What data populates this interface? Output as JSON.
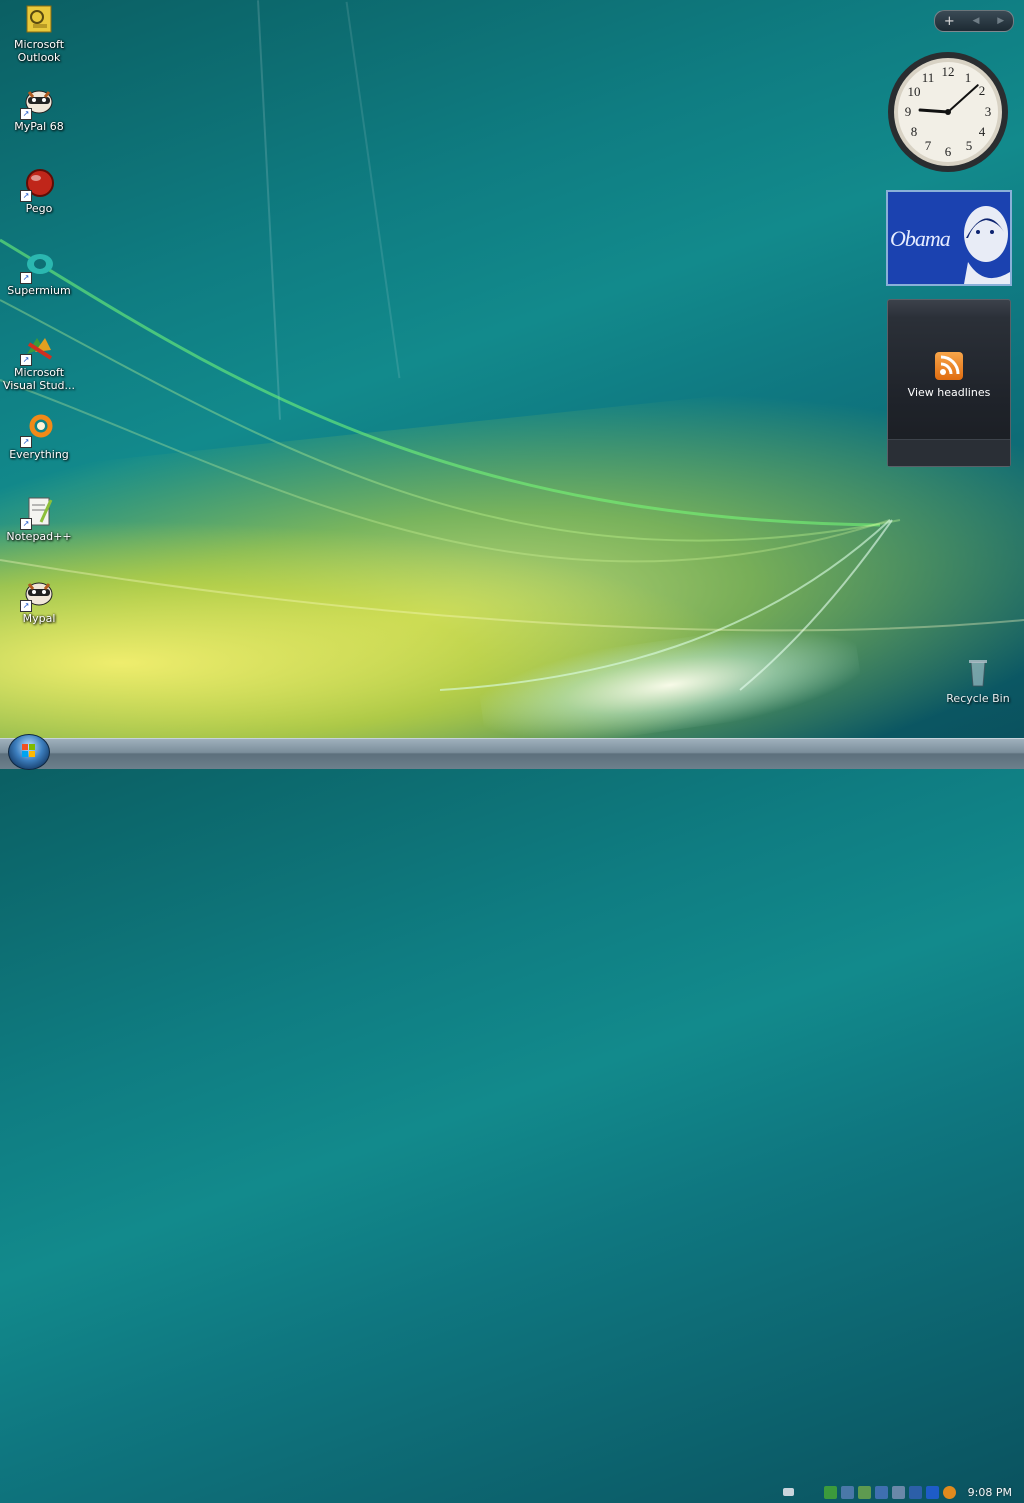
{
  "desktop": {
    "icons": [
      {
        "label": "Microsoft Outlook",
        "icon": "outlook-icon"
      },
      {
        "label": "MyPal 68",
        "icon": "raccoon-icon"
      },
      {
        "label": "Pego",
        "icon": "red-orb-icon"
      },
      {
        "label": "Supermium",
        "icon": "teal-browser-icon"
      },
      {
        "label": "Microsoft Visual Stud...",
        "icon": "visual-studio-icon"
      },
      {
        "label": "Everything",
        "icon": "orange-search-icon"
      },
      {
        "label": "Notepad++",
        "icon": "notepad-plus-plus-icon"
      },
      {
        "label": "Mypal",
        "icon": "raccoon-icon"
      }
    ],
    "recycle_bin": {
      "label": "Recycle Bin",
      "icon": "recycle-bin-icon"
    }
  },
  "sidebar": {
    "add_label": "+",
    "clock": {
      "hours": 9,
      "minutes": 8
    },
    "photo_caption": "Obama",
    "feed": {
      "label": "View headlines",
      "icon": "rss-icon"
    }
  },
  "taskbar": {
    "start_icon": "windows-orb-icon",
    "time": "9:08 PM"
  },
  "colors": {
    "accent": "#1a56c8",
    "feed_orange": "#f08a2a",
    "taskbar": "#7b8e9b"
  }
}
